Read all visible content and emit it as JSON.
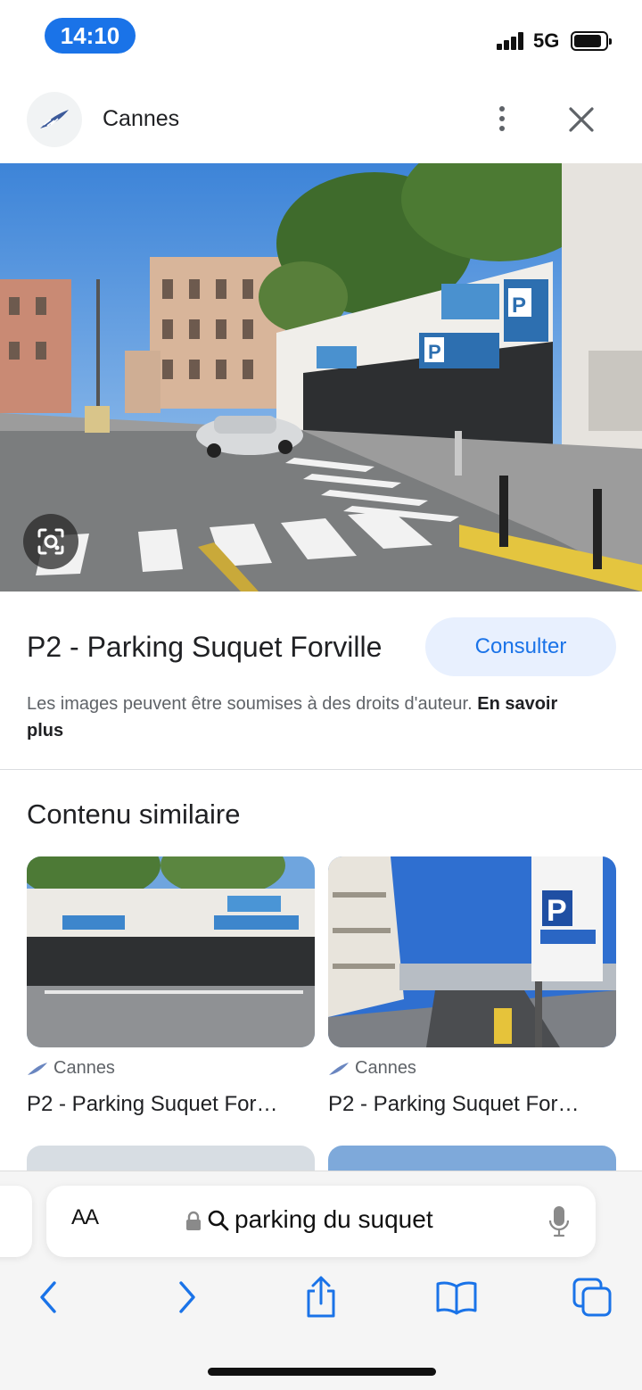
{
  "status": {
    "time": "14:10",
    "network": "5G"
  },
  "header": {
    "title": "Cannes",
    "logo_icon": "feather-logo-icon",
    "more_icon": "more-vertical-icon",
    "close_icon": "close-icon"
  },
  "result": {
    "title": "P2 - Parking Suquet Forville",
    "consult_label": "Consulter",
    "copyright_text": "Les images peuvent être soumises à des droits d'auteur.",
    "learn_more": "En savoir plus"
  },
  "similar": {
    "heading": "Contenu similaire",
    "items": [
      {
        "source": "Cannes",
        "title": "P2 - Parking Suquet For…"
      },
      {
        "source": "Cannes",
        "title": "P2 - Parking Suquet For…"
      }
    ]
  },
  "browser": {
    "text_size_label": "AA",
    "url": "parking du suquet",
    "icons": [
      "back-icon",
      "forward-icon",
      "share-icon",
      "bookmarks-icon",
      "tabs-icon"
    ]
  },
  "colors": {
    "accent": "#1a73e8",
    "consult_bg": "#e8f0fe"
  }
}
